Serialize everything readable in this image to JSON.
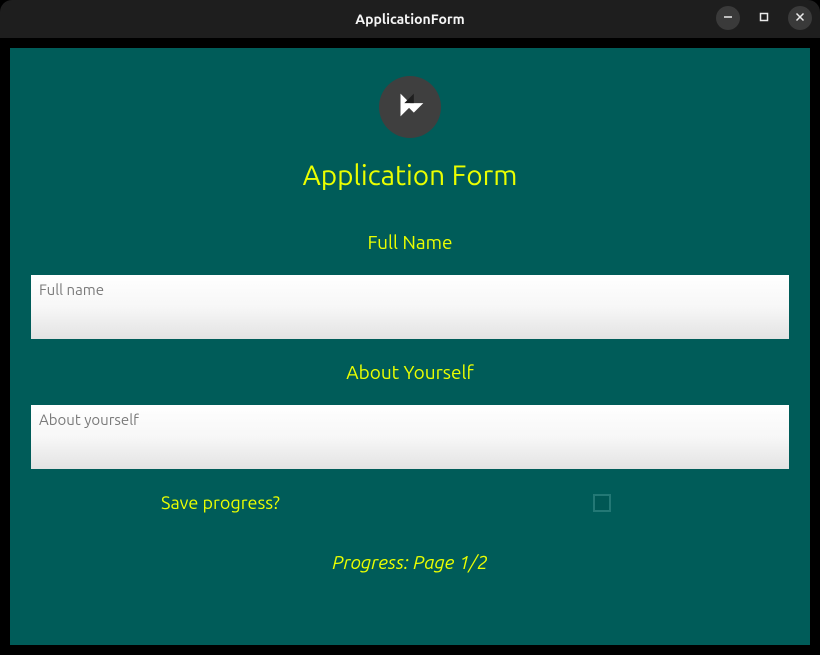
{
  "window": {
    "title": "ApplicationForm"
  },
  "header": {
    "logo_icon": "kivy-logo",
    "title": "Application Form"
  },
  "fields": {
    "fullname": {
      "label": "Full Name",
      "placeholder": "Full name",
      "value": ""
    },
    "about": {
      "label": "About Yourself",
      "placeholder": "About yourself",
      "value": ""
    }
  },
  "save": {
    "label": "Save progress?",
    "checked": false
  },
  "progress": {
    "text": "Progress: Page 1/2"
  },
  "colors": {
    "background": "#005c59",
    "accent": "#eaff00"
  }
}
